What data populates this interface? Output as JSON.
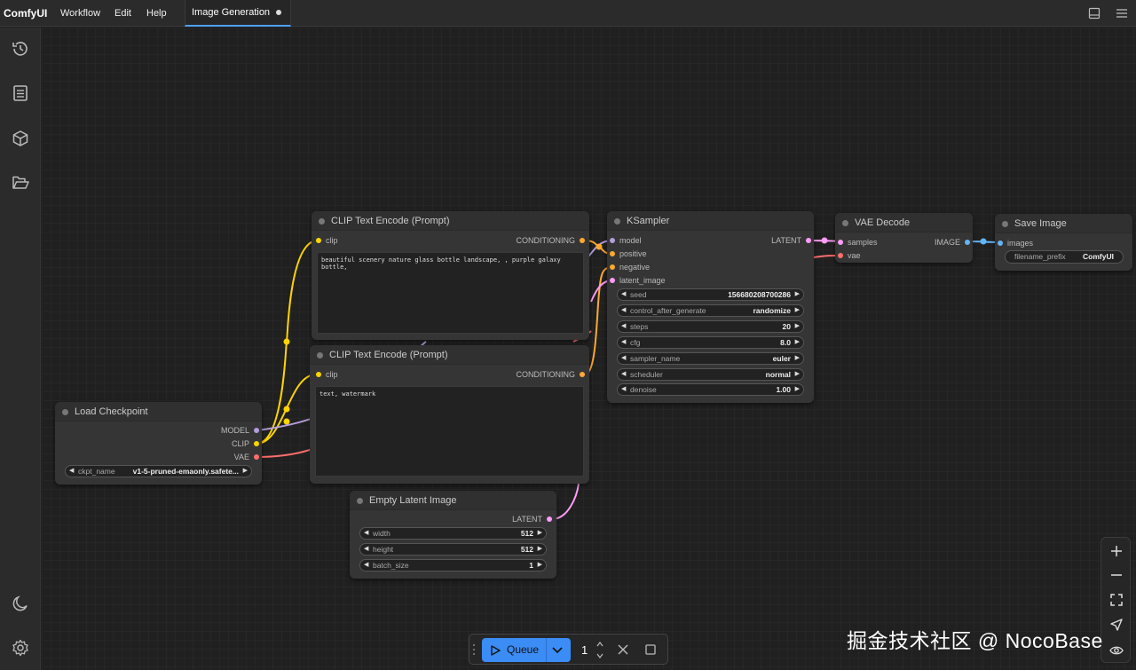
{
  "menubar": {
    "logo": "ComfyUI",
    "items": [
      "Workflow",
      "Edit",
      "Help"
    ],
    "tab_title": "Image Generation"
  },
  "colors": {
    "accent": "#4ea1ff",
    "clip": "#ffd500",
    "model": "#b39ddb",
    "vae": "#ff6e6e",
    "conditioning": "#ffa931",
    "latent": "#ff9cf9",
    "image": "#64b5f6",
    "queue_button": "#3b8cf5"
  },
  "sidebar": {
    "icons": [
      "history-icon",
      "document-icon",
      "cube-icon",
      "folder-icon",
      "moon-icon",
      "gear-icon"
    ]
  },
  "nodes": {
    "clip_pos": {
      "title": "CLIP Text Encode (Prompt)",
      "input": "clip",
      "output": "CONDITIONING",
      "text": "beautiful scenery nature glass bottle landscape, , purple galaxy bottle,"
    },
    "clip_neg": {
      "title": "CLIP Text Encode (Prompt)",
      "input": "clip",
      "output": "CONDITIONING",
      "text": "text, watermark"
    },
    "ksampler": {
      "title": "KSampler",
      "inputs": [
        "model",
        "positive",
        "negative",
        "latent_image"
      ],
      "output": "LATENT",
      "widgets": [
        {
          "name": "seed",
          "value": "156680208700286"
        },
        {
          "name": "control_after_generate",
          "value": "randomize"
        },
        {
          "name": "steps",
          "value": "20"
        },
        {
          "name": "cfg",
          "value": "8.0"
        },
        {
          "name": "sampler_name",
          "value": "euler"
        },
        {
          "name": "scheduler",
          "value": "normal"
        },
        {
          "name": "denoise",
          "value": "1.00"
        }
      ]
    },
    "vae_decode": {
      "title": "VAE Decode",
      "inputs": [
        "samples",
        "vae"
      ],
      "output": "IMAGE"
    },
    "save_image": {
      "title": "Save Image",
      "input": "images",
      "widget": {
        "name": "filename_prefix",
        "value": "ComfyUI"
      }
    },
    "load_checkpoint": {
      "title": "Load Checkpoint",
      "outputs": [
        "MODEL",
        "CLIP",
        "VAE"
      ],
      "widget": {
        "name": "ckpt_name",
        "value": "v1-5-pruned-emaonly.safete..."
      }
    },
    "empty_latent": {
      "title": "Empty Latent Image",
      "output": "LATENT",
      "widgets": [
        {
          "name": "width",
          "value": "512"
        },
        {
          "name": "height",
          "value": "512"
        },
        {
          "name": "batch_size",
          "value": "1"
        }
      ]
    }
  },
  "queue": {
    "label": "Queue",
    "count": "1"
  },
  "watermark": "掘金技术社区 @ NocoBase"
}
